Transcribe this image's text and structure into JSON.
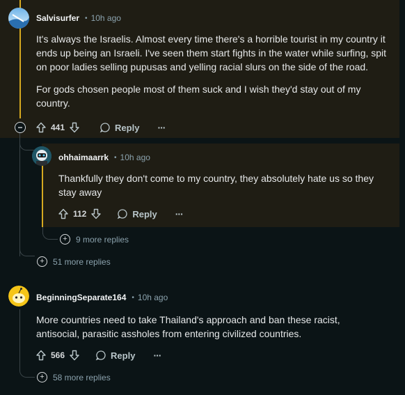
{
  "comments": [
    {
      "username": "Salvisurfer",
      "time": "10h ago",
      "body": [
        "It's always the Israelis. Almost every time there's a horrible tourist in my country it ends up being an Israeli. I've seen them start fights in the water while surfing, spit on poor ladies selling pupusas and yelling racial slurs on the side of the road.",
        "For gods chosen people most of them suck and I wish they'd stay out of my country."
      ],
      "score": "441",
      "reply_label": "Reply",
      "more_replies": "51 more replies"
    },
    {
      "username": "ohhaimaarrk",
      "time": "10h ago",
      "body": [
        "Thankfully they don't come to my country, they absolutely hate us so they stay away"
      ],
      "score": "112",
      "reply_label": "Reply",
      "more_replies": "9 more replies"
    },
    {
      "username": "BeginningSeparate164",
      "time": "10h ago",
      "body": [
        "More countries need to take Thailand's approach and ban these racist, antisocial, parasitic assholes from entering civilized countries."
      ],
      "score": "566",
      "reply_label": "Reply",
      "more_replies": "58 more replies"
    }
  ],
  "meta_separator": "•",
  "overflow_glyph": "···",
  "collapse_glyph": "−",
  "more_glyph": "+",
  "colors": {
    "background": "#0b1416",
    "highlight_bg": "#1f1d14",
    "highlight_border": "#d6a920",
    "thread_line": "#3a4448"
  }
}
